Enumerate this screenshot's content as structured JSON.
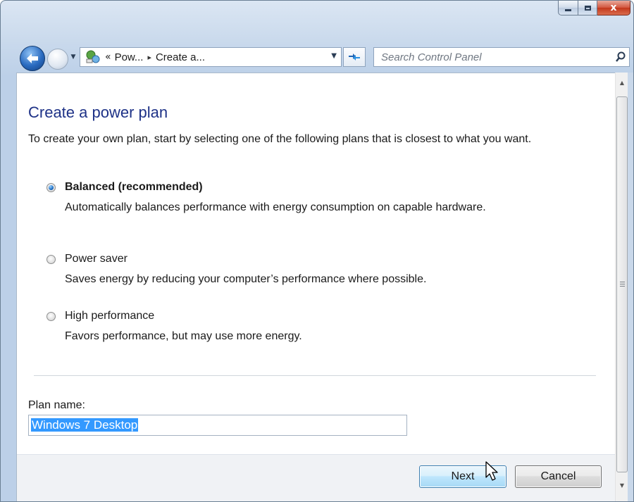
{
  "window": {
    "caption": {
      "minimize_icon": "minimize-icon",
      "maximize_icon": "maximize-icon",
      "close_label": "x"
    }
  },
  "navbar": {
    "breadcrumb_overflow": "«",
    "breadcrumb": [
      "Pow...",
      "Create a..."
    ],
    "breadcrumb_separator": "▸",
    "search_placeholder": "Search Control Panel"
  },
  "main": {
    "title": "Create a power plan",
    "intro": "To create your own plan, start by selecting one of the following plans that is closest to what you want.",
    "plans": [
      {
        "label": "Balanced (recommended)",
        "description": "Automatically balances performance with energy consumption on capable hardware.",
        "selected": true
      },
      {
        "label": "Power saver",
        "description": "Saves energy by reducing your computer’s performance where possible.",
        "selected": false
      },
      {
        "label": "High performance",
        "description": "Favors performance, but may use more energy.",
        "selected": false
      }
    ],
    "plan_name_label": "Plan name:",
    "plan_name_value": "Windows 7 Desktop"
  },
  "footer": {
    "next_label": "Next",
    "cancel_label": "Cancel"
  },
  "colors": {
    "title": "#1e3287",
    "selection": "#3399ff",
    "close_button": "#c3371c"
  }
}
